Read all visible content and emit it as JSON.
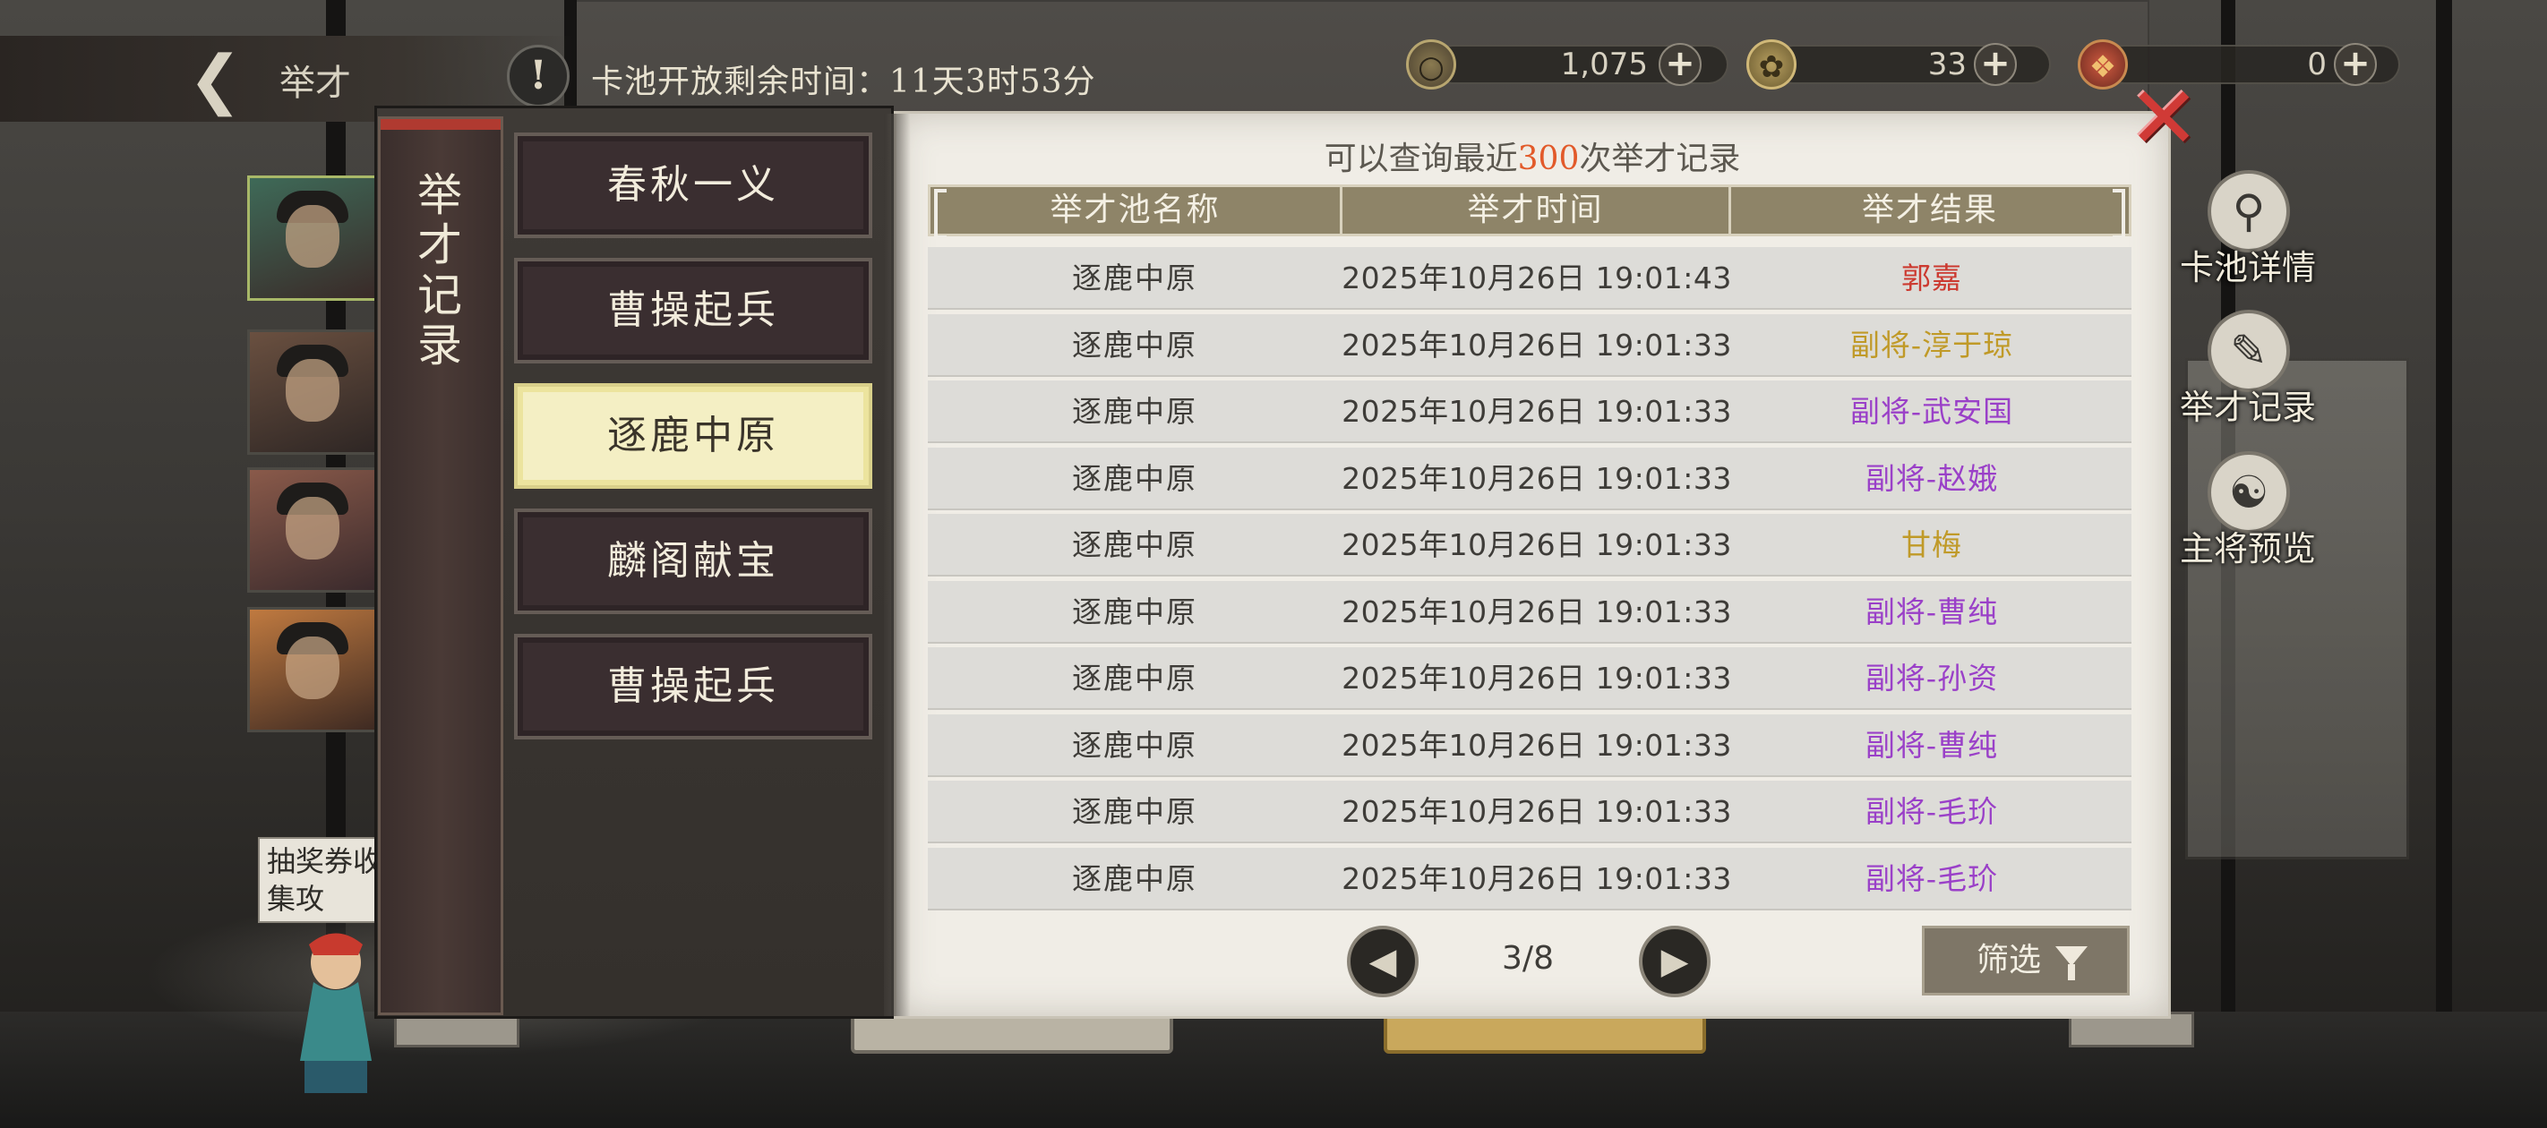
{
  "topbar": {
    "back_label": "举才",
    "info_icon_text": "!",
    "pool_timer": "卡池开放剩余时间：11天3时53分",
    "currencies": [
      {
        "name": "coin",
        "value": "1,075",
        "icon": "coin-icon"
      },
      {
        "name": "token",
        "value": "33",
        "icon": "token-icon"
      },
      {
        "name": "gem",
        "value": "0",
        "icon": "gem-icon"
      }
    ],
    "plus_label": "+"
  },
  "side_note": "抽奖券收集攻",
  "right_buttons": [
    {
      "label": "卡池详情",
      "icon": "magnifier-icon"
    },
    {
      "label": "举才记录",
      "icon": "scroll-icon"
    },
    {
      "label": "主将预览",
      "icon": "preview-icon"
    }
  ],
  "modal": {
    "title": "举才记录",
    "close_label": "✕",
    "pool_tabs": [
      "春秋一义",
      "曹操起兵",
      "逐鹿中原",
      "麟阁献宝",
      "曹操起兵"
    ],
    "active_tab_index": 2,
    "query_prefix": "可以查询最近",
    "query_count": "300",
    "query_suffix": "次举才记录",
    "columns": [
      "举才池名称",
      "举才时间",
      "举才结果"
    ],
    "rows": [
      {
        "pool": "逐鹿中原",
        "time": "2025年10月26日 19:01:43",
        "result": "郭嘉",
        "color": "#cc3a30"
      },
      {
        "pool": "逐鹿中原",
        "time": "2025年10月26日 19:01:33",
        "result": "副将-淳于琼",
        "color": "#c09a28"
      },
      {
        "pool": "逐鹿中原",
        "time": "2025年10月26日 19:01:33",
        "result": "副将-武安国",
        "color": "#9a40c8"
      },
      {
        "pool": "逐鹿中原",
        "time": "2025年10月26日 19:01:33",
        "result": "副将-赵娥",
        "color": "#9a40c8"
      },
      {
        "pool": "逐鹿中原",
        "time": "2025年10月26日 19:01:33",
        "result": "甘梅",
        "color": "#c09a28"
      },
      {
        "pool": "逐鹿中原",
        "time": "2025年10月26日 19:01:33",
        "result": "副将-曹纯",
        "color": "#9a40c8"
      },
      {
        "pool": "逐鹿中原",
        "time": "2025年10月26日 19:01:33",
        "result": "副将-孙资",
        "color": "#9a40c8"
      },
      {
        "pool": "逐鹿中原",
        "time": "2025年10月26日 19:01:33",
        "result": "副将-曹纯",
        "color": "#9a40c8"
      },
      {
        "pool": "逐鹿中原",
        "time": "2025年10月26日 19:01:33",
        "result": "副将-毛玠",
        "color": "#9a40c8"
      },
      {
        "pool": "逐鹿中原",
        "time": "2025年10月26日 19:01:33",
        "result": "副将-毛玠",
        "color": "#9a40c8"
      }
    ],
    "pager": {
      "text": "3/8",
      "prev_icon": "prev-arrow-icon",
      "next_icon": "next-arrow-icon"
    },
    "filter_label": "筛选"
  }
}
